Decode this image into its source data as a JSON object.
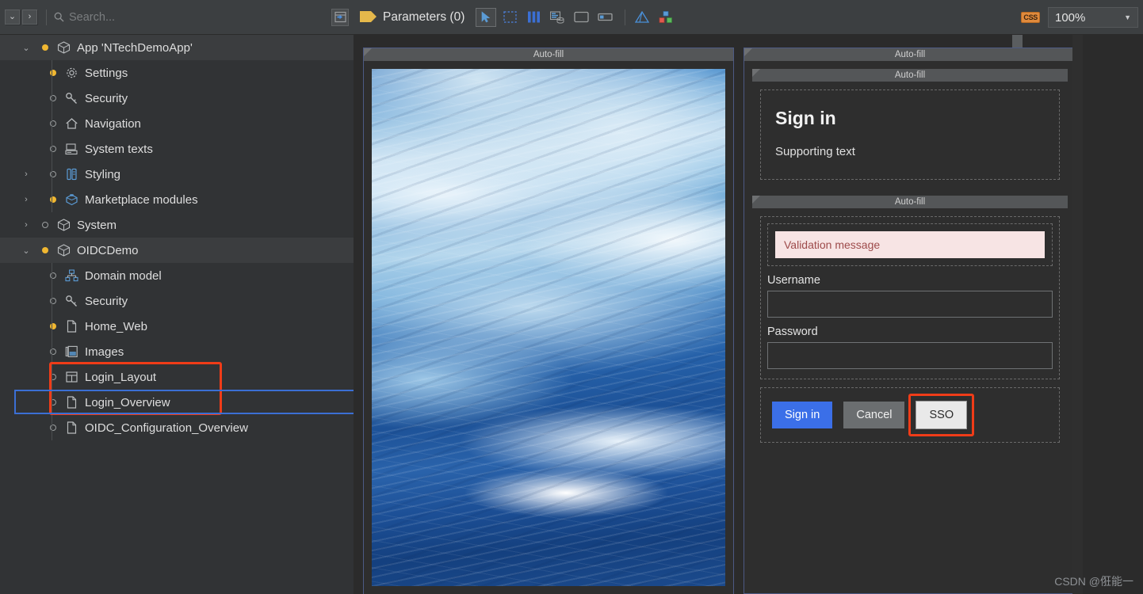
{
  "search": {
    "placeholder": "Search...",
    "collapse_all_icon": "chevron-down-icon",
    "expand_all_icon": "chevron-right-icon",
    "search_icon": "search-icon",
    "collapse_panel_icon": "collapse-panel-icon"
  },
  "tree": {
    "items": [
      {
        "label": "App 'NTechDemoApp'",
        "twisty": "⌄",
        "bullet": "filled",
        "icon": "package-icon",
        "indent": 0,
        "highlight": true
      },
      {
        "label": "Settings",
        "twisty": "",
        "bullet": "filled",
        "icon": "gear-icon",
        "indent": 1,
        "highlight": false
      },
      {
        "label": "Security",
        "twisty": "",
        "bullet": "hollow",
        "icon": "key-icon",
        "indent": 1,
        "highlight": false
      },
      {
        "label": "Navigation",
        "twisty": "",
        "bullet": "hollow",
        "icon": "home-icon",
        "indent": 1,
        "highlight": false
      },
      {
        "label": "System texts",
        "twisty": "",
        "bullet": "hollow",
        "icon": "system-texts-icon",
        "indent": 1,
        "highlight": false
      },
      {
        "label": "Styling",
        "twisty": "›",
        "bullet": "hollow",
        "icon": "styling-icon",
        "indent": 1,
        "highlight": false
      },
      {
        "label": "Marketplace modules",
        "twisty": "›",
        "bullet": "filled",
        "icon": "marketplace-icon",
        "indent": 1,
        "highlight": false
      },
      {
        "label": "System",
        "twisty": "›",
        "bullet": "hollow",
        "icon": "module-icon",
        "indent": 0,
        "highlight": false
      },
      {
        "label": "OIDCDemo",
        "twisty": "⌄",
        "bullet": "filled",
        "icon": "module-icon",
        "indent": 0,
        "highlight": true
      },
      {
        "label": "Domain model",
        "twisty": "",
        "bullet": "hollow",
        "icon": "domain-model-icon",
        "indent": 1,
        "highlight": false
      },
      {
        "label": "Security",
        "twisty": "",
        "bullet": "hollow",
        "icon": "key-icon",
        "indent": 1,
        "highlight": false
      },
      {
        "label": "Home_Web",
        "twisty": "",
        "bullet": "filled",
        "icon": "page-icon",
        "indent": 1,
        "highlight": false
      },
      {
        "label": "Images",
        "twisty": "",
        "bullet": "hollow",
        "icon": "images-icon",
        "indent": 1,
        "highlight": false
      },
      {
        "label": "Login_Layout",
        "twisty": "",
        "bullet": "hollow",
        "icon": "layout-icon",
        "indent": 1,
        "highlight": false
      },
      {
        "label": "Login_Overview",
        "twisty": "",
        "bullet": "hollow",
        "icon": "page-icon",
        "indent": 1,
        "highlight": false
      },
      {
        "label": "OIDC_Configuration_Overview",
        "twisty": "",
        "bullet": "hollow",
        "icon": "page-icon",
        "indent": 1,
        "highlight": false
      }
    ],
    "annotation_color": "#f03c18",
    "selection_color": "#3b6fd4"
  },
  "toolbar": {
    "params_label": "Parameters (0)",
    "params_flag_icon": "flag-icon",
    "icons": [
      "pointer-select-icon",
      "marquee-select-icon",
      "columns-icon",
      "data-grid-icon",
      "container-icon",
      "text-box-icon",
      "pyramid-icon",
      "modules-icon"
    ],
    "css_badge": "CSS",
    "zoom_value": "100%",
    "zoom_caret_icon": "chevron-down-icon"
  },
  "canvas": {
    "autofill_label": "Auto-fill",
    "form": {
      "title": "Sign in",
      "supporting_text": "Supporting text",
      "validation_message": "Validation message",
      "username_label": "Username",
      "username_value": "",
      "password_label": "Password",
      "password_value": "",
      "buttons": {
        "signin": "Sign in",
        "cancel": "Cancel",
        "sso": "SSO"
      }
    },
    "colors": {
      "primary_button": "#3b6fe8",
      "cancel_button": "#6b6e70",
      "sso_button": "#e9e9e9",
      "validation_bg": "#f7e4e4",
      "validation_text": "#9e4b4b",
      "selection_outline": "#4d5a84"
    }
  },
  "watermark": "CSDN @俇能一"
}
